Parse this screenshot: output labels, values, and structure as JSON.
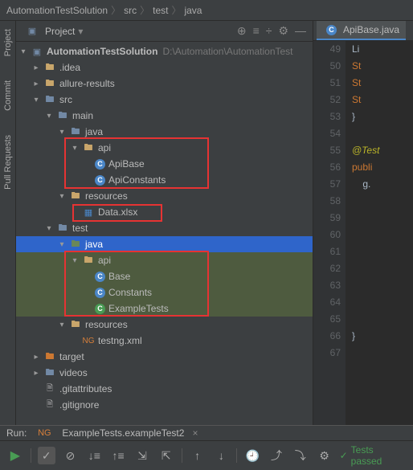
{
  "breadcrumb": {
    "root": "AutomationTestSolution",
    "p1": "src",
    "p2": "test",
    "p3": "java"
  },
  "leftTabs": {
    "project": "Project",
    "commit": "Commit",
    "pull": "Pull Requests"
  },
  "panel": {
    "title": "Project"
  },
  "tree": {
    "root": "AutomationTestSolution",
    "rootPath": "D:\\Automation\\AutomationTest",
    "idea": ".idea",
    "allure": "allure-results",
    "src": "src",
    "main": "main",
    "java": "java",
    "api": "api",
    "apiBase": "ApiBase",
    "apiConstants": "ApiConstants",
    "resources": "resources",
    "dataXlsx": "Data.xlsx",
    "test": "test",
    "base": "Base",
    "constants": "Constants",
    "exampleTests": "ExampleTests",
    "testng": "testng.xml",
    "target": "target",
    "videos": "videos",
    "gitattr": ".gitattributes",
    "gitignore": ".gitignore"
  },
  "editor": {
    "tabName": "ApiBase.java",
    "lines": {
      "l49": "Li",
      "l50": "St",
      "l51": "St",
      "l52": "St",
      "l53": "}",
      "l55": "@Test",
      "l56": "publi",
      "l57": "    g.",
      "l66": "}"
    }
  },
  "lineNumbers": [
    "49",
    "50",
    "51",
    "52",
    "53",
    "54",
    "55",
    "56",
    "57",
    "58",
    "59",
    "60",
    "61",
    "62",
    "63",
    "64",
    "65",
    "66",
    "67"
  ],
  "run": {
    "label": "Run:",
    "tab": "ExampleTests.exampleTest2",
    "passed": "Tests passed"
  }
}
